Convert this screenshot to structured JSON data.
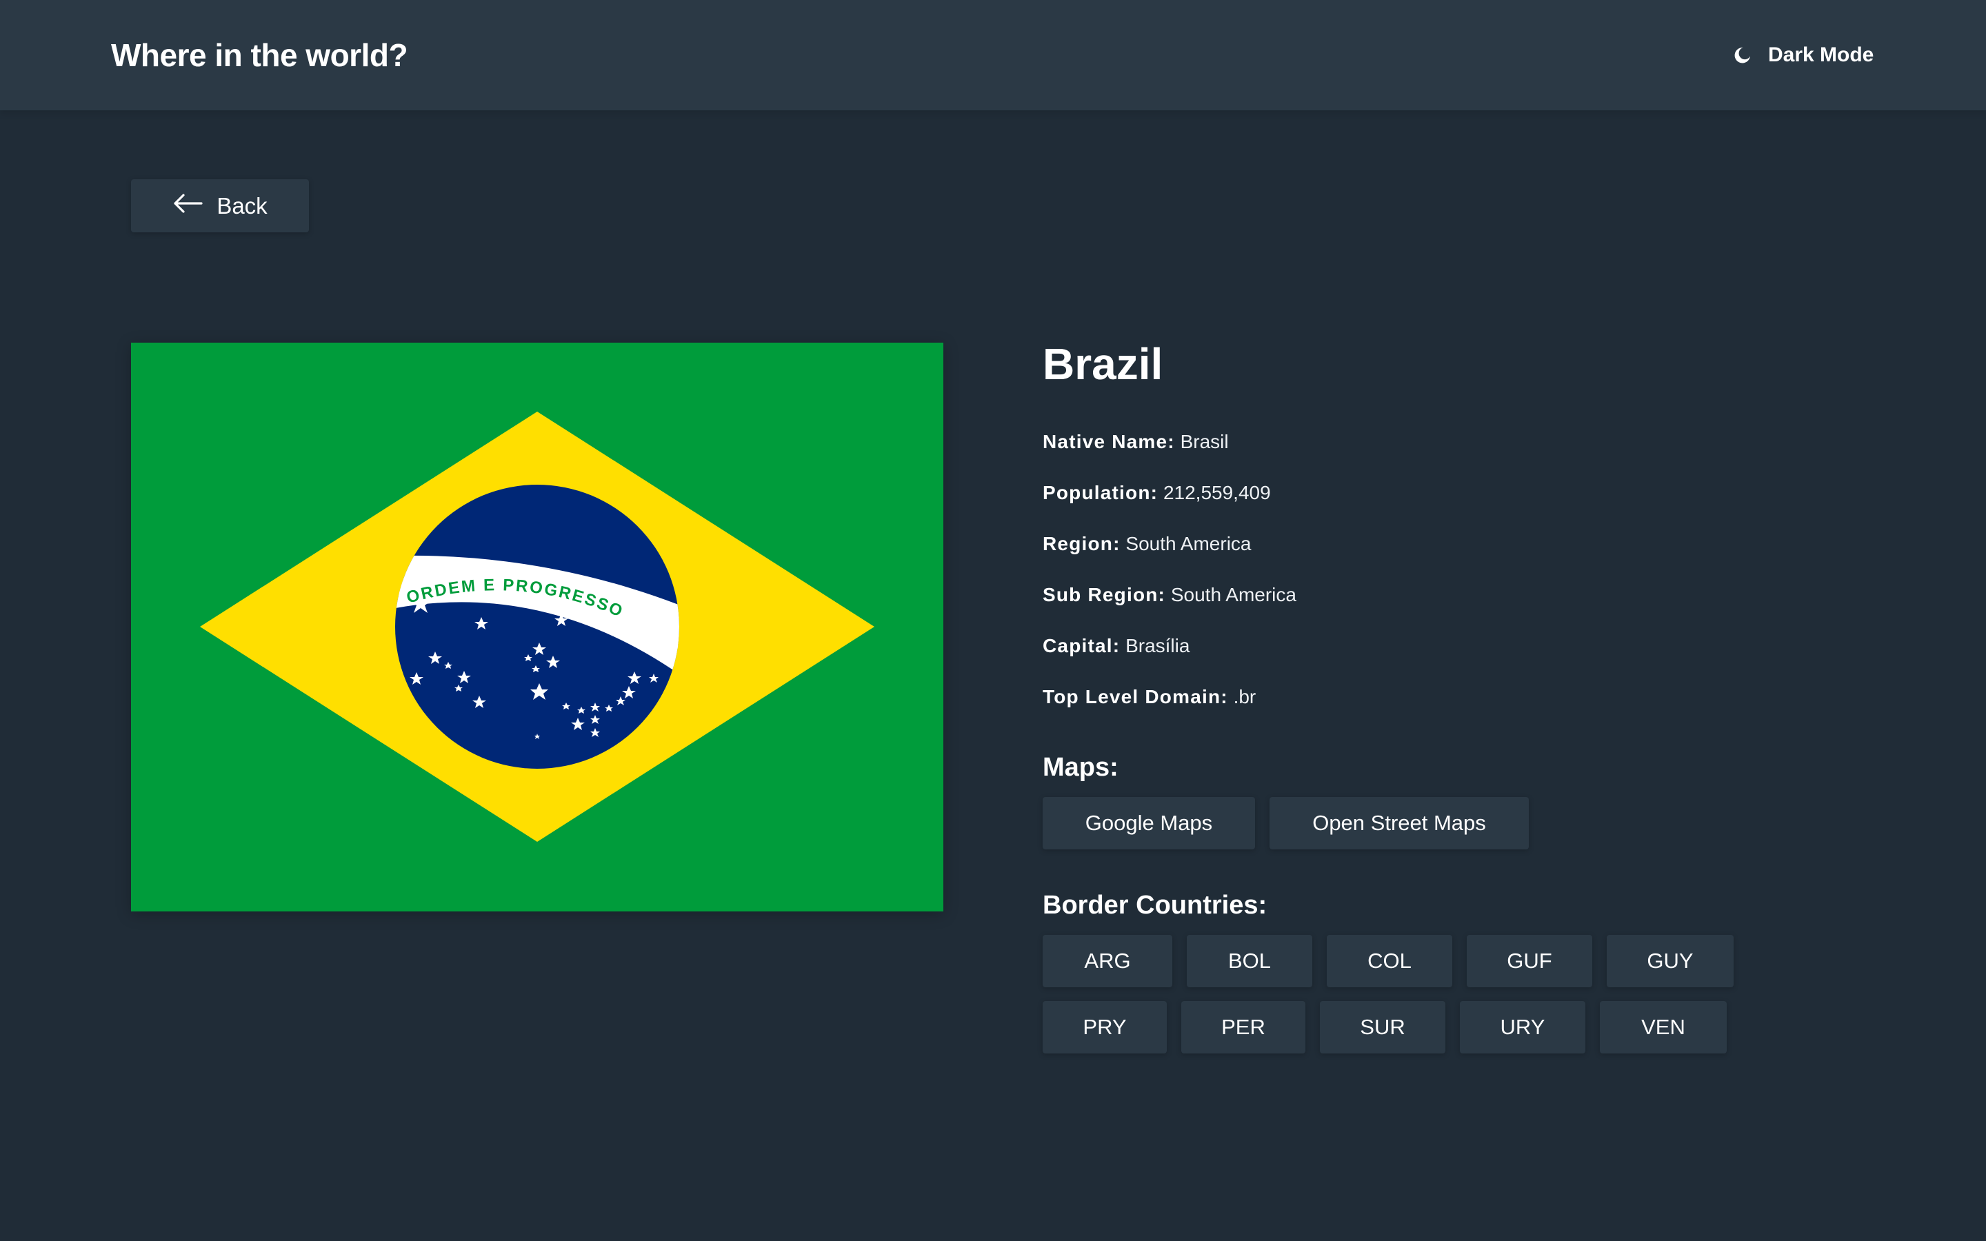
{
  "header": {
    "title": "Where in the world?",
    "mode_toggle_label": "Dark Mode",
    "mode_icon": "moon-icon"
  },
  "back": {
    "label": "Back",
    "icon": "arrow-left-icon"
  },
  "flag": {
    "icon": "brazil-flag",
    "motto": "ORDEM E PROGRESSO",
    "colors": {
      "green": "#009c3b",
      "yellow": "#ffdf00",
      "blue": "#002776",
      "white": "#ffffff"
    }
  },
  "country": {
    "name": "Brazil",
    "fields": [
      {
        "label": "Native Name:",
        "value": "Brasil"
      },
      {
        "label": "Population:",
        "value": "212,559,409"
      },
      {
        "label": "Region:",
        "value": "South America"
      },
      {
        "label": "Sub Region:",
        "value": "South America"
      },
      {
        "label": "Capital:",
        "value": "Brasília"
      },
      {
        "label": "Top Level Domain:",
        "value": ".br"
      }
    ]
  },
  "maps": {
    "heading": "Maps:",
    "links": [
      "Google Maps",
      "Open Street Maps"
    ]
  },
  "borders": {
    "heading": "Border Countries:",
    "row1": [
      "ARG",
      "BOL",
      "COL",
      "GUF",
      "GUY"
    ],
    "row2": [
      "PRY",
      "PER",
      "SUR",
      "URY",
      "VEN"
    ]
  },
  "theme": {
    "background": "#202c37",
    "elements": "#2b3945",
    "text": "#ffffff"
  }
}
